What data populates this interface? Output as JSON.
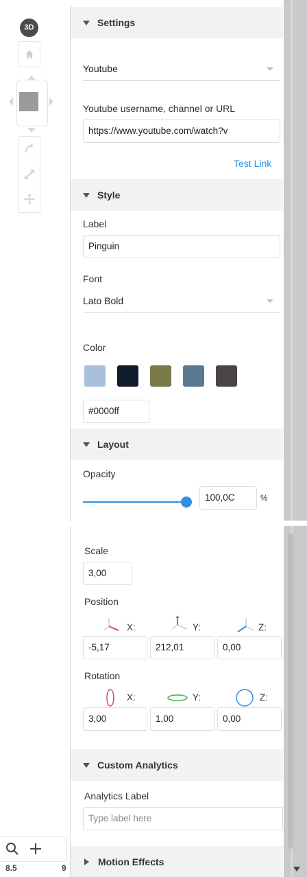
{
  "toolbar": {
    "badge_3d": "3D",
    "icons": [
      "home-icon",
      "rotate-icon",
      "resize-icon",
      "move-icon",
      "search-icon",
      "plus-icon"
    ],
    "zoom_left": "8.5",
    "zoom_right": "9"
  },
  "settings": {
    "title": "Settings",
    "source_select": "Youtube",
    "url_label": "Youtube username, channel or URL",
    "url_value": "https://www.youtube.com/watch?v",
    "test_link": "Test Link"
  },
  "style": {
    "title": "Style",
    "label_label": "Label",
    "label_value": "Pinguin",
    "font_label": "Font",
    "font_value": "Lato Bold",
    "color_label": "Color",
    "swatches": [
      "#a9c0da",
      "#101c2b",
      "#7a7a4a",
      "#5b7891",
      "#4b4447"
    ],
    "hex_value": "#0000ff"
  },
  "layout": {
    "title": "Layout",
    "opacity_label": "Opacity",
    "opacity_value": "100,0C",
    "opacity_percent": 100,
    "opacity_unit": "%",
    "scale_label": "Scale",
    "scale_value": "3,00",
    "position_label": "Position",
    "position": {
      "x_label": "X:",
      "y_label": "Y:",
      "z_label": "Z:",
      "x": "-5,17",
      "y": "212,01",
      "z": "0,00"
    },
    "rotation_label": "Rotation",
    "rotation": {
      "x_label": "X:",
      "y_label": "Y:",
      "z_label": "Z:",
      "x": "3,00",
      "y": "1,00",
      "z": "0,00"
    }
  },
  "analytics": {
    "title": "Custom Analytics",
    "label": "Analytics Label",
    "placeholder": "Type label here"
  },
  "motion": {
    "title": "Motion Effects"
  },
  "colors": {
    "accent": "#2f8fe0",
    "axis_x": "#e04b4b",
    "axis_y": "#3cb043",
    "axis_z": "#2f8fe0"
  }
}
